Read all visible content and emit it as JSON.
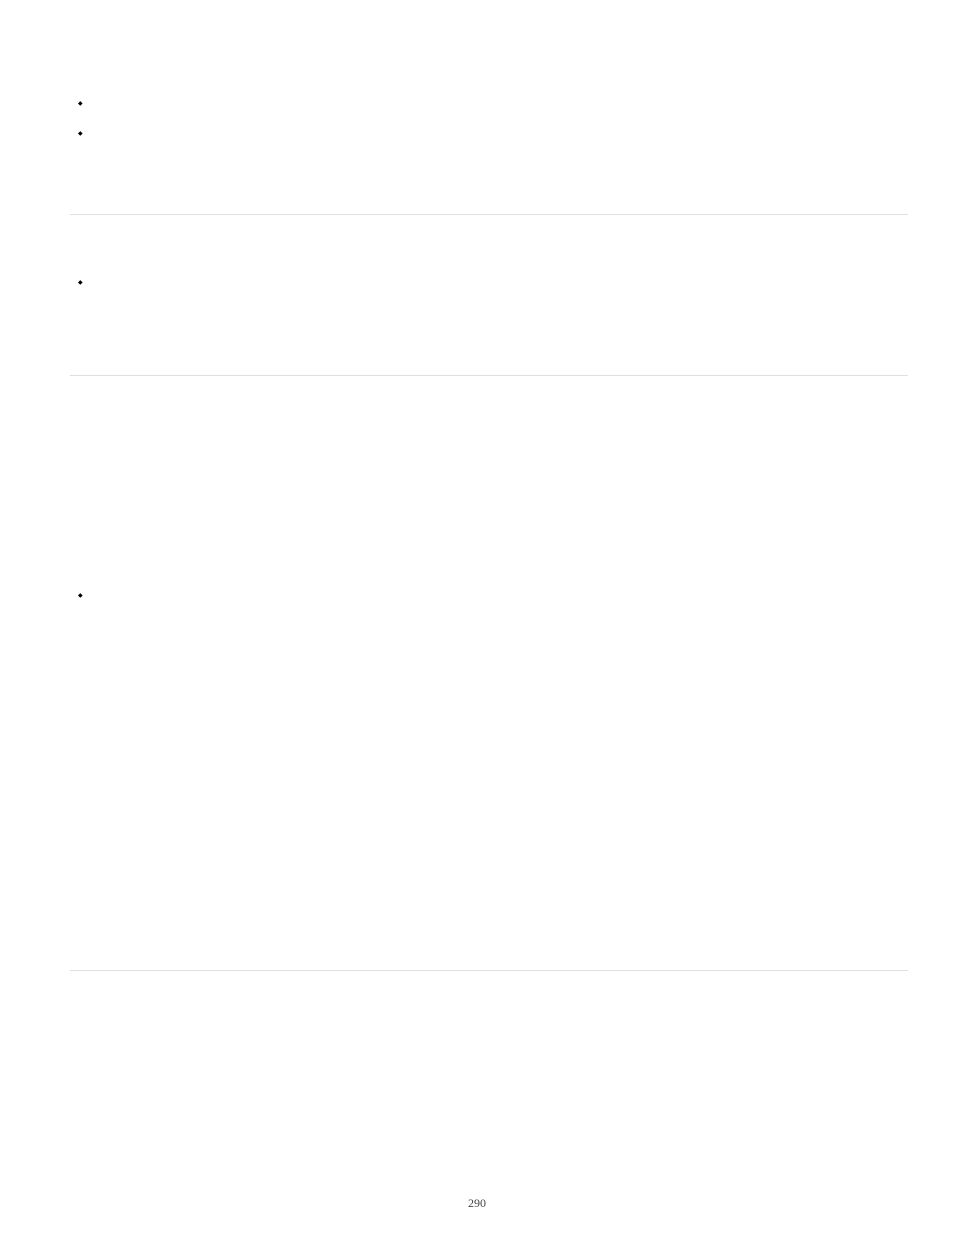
{
  "bullets": {
    "b1": "◆",
    "b2": "◆",
    "b3": "◆",
    "b4": "◆"
  },
  "page_number": "290"
}
